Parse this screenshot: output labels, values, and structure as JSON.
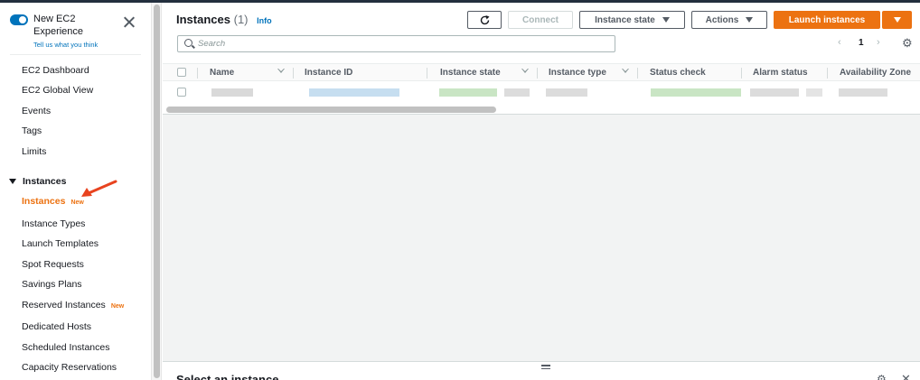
{
  "experience": {
    "title": "New EC2 Experience",
    "link": "Tell us what you think"
  },
  "sidebar": {
    "top_items": [
      "EC2 Dashboard",
      "EC2 Global View",
      "Events",
      "Tags",
      "Limits"
    ],
    "section": "Instances",
    "section_items": [
      {
        "label": "Instances",
        "badge": "New",
        "active": true
      },
      {
        "label": "Instance Types"
      },
      {
        "label": "Launch Templates"
      },
      {
        "label": "Spot Requests"
      },
      {
        "label": "Savings Plans"
      },
      {
        "label": "Reserved Instances",
        "badge": "New"
      },
      {
        "label": "Dedicated Hosts"
      },
      {
        "label": "Scheduled Instances"
      },
      {
        "label": "Capacity Reservations"
      }
    ]
  },
  "header": {
    "title": "Instances",
    "count": "(1)",
    "info": "Info",
    "buttons": {
      "connect": "Connect",
      "instance_state": "Instance state",
      "actions": "Actions",
      "launch": "Launch instances"
    }
  },
  "search": {
    "placeholder": "Search"
  },
  "pagination": {
    "page": "1"
  },
  "table": {
    "columns": [
      "Name",
      "Instance ID",
      "Instance state",
      "Instance type",
      "Status check",
      "Alarm status",
      "Availability Zone"
    ]
  },
  "bottom_pane": {
    "title": "Select an instance"
  },
  "colors": {
    "accent": "#ec7211",
    "link": "#0073bb"
  },
  "icons": [
    "toggle-icon",
    "close-icon",
    "caret-down-icon",
    "refresh-icon",
    "search-icon",
    "chevron-left-icon",
    "chevron-right-icon",
    "gear-icon",
    "arrow-annotation-icon"
  ]
}
